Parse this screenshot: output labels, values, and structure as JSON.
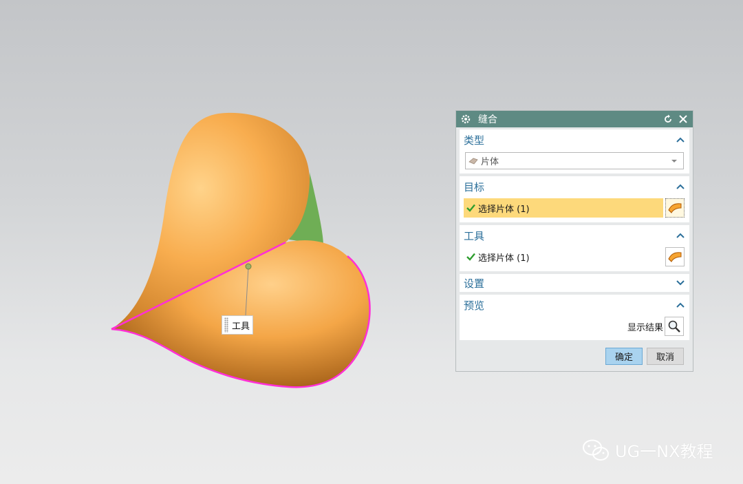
{
  "viewport": {
    "tool_callout": "工具"
  },
  "dialog": {
    "title": "缝合",
    "icons": {
      "title": "gear-icon",
      "reset": "reset-icon",
      "close": "close-icon"
    },
    "sections": {
      "type": {
        "label": "类型",
        "expanded": true,
        "dropdown_value": "片体"
      },
      "target": {
        "label": "目标",
        "expanded": true,
        "select_label": "选择片体 (1)"
      },
      "tool": {
        "label": "工具",
        "expanded": true,
        "select_label": "选择片体 (1)"
      },
      "settings": {
        "label": "设置",
        "expanded": false
      },
      "preview": {
        "label": "预览",
        "expanded": true,
        "show_result_label": "显示结果"
      }
    },
    "buttons": {
      "ok": "确定",
      "cancel": "取消"
    },
    "colors": {
      "titlebar": "#5e8a83",
      "section_header": "#2b6f9a",
      "active_row": "#fdd97b",
      "ok_button": "#a9d3ef"
    }
  },
  "watermark": {
    "text": "UG一NX教程",
    "icon": "wechat-icon"
  }
}
